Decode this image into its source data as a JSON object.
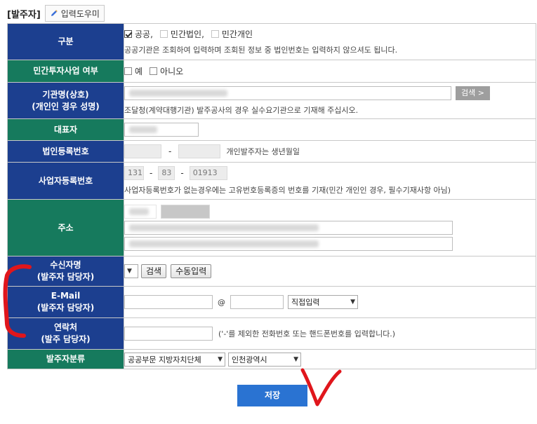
{
  "header": {
    "section_title": "[발주자]",
    "helper_button": "입력도우미"
  },
  "rows": {
    "category": {
      "label": "구분",
      "options": [
        {
          "label": "공공,",
          "checked": true
        },
        {
          "label": "민간법인,",
          "checked": false
        },
        {
          "label": "민간개인",
          "checked": false
        }
      ],
      "note": "공공기관은 조회하여 입력하며 조회된 정보 중 법인번호는 입력하지 않으셔도 됩니다."
    },
    "private_investment": {
      "label": "민간투자사업 여부",
      "options": [
        {
          "label": "예"
        },
        {
          "label": "아니오"
        }
      ]
    },
    "org_name": {
      "label_line1": "기관명(상호)",
      "label_line2": "(개인인 경우 성명)",
      "search_button": "검색 >",
      "note": "조달청(계약대행기관) 발주공사의 경우 실수요기관으로 기재해 주십시오."
    },
    "representative": {
      "label": "대표자"
    },
    "corp_reg_no": {
      "label": "법인등록번호",
      "separator": "-",
      "note": "개인발주자는 생년월일"
    },
    "biz_reg_no": {
      "label": "사업자등록번호",
      "part1": "131",
      "part2": "83",
      "part3": "01913",
      "separator": "-",
      "note": "사업자등록번호가 없는경우에는 고유번호등록증의 번호를 기재(민간 개인인 경우, 필수기재사항 아님)"
    },
    "address": {
      "label": "주소"
    },
    "recipient": {
      "label_line1": "수신자명",
      "label_line2": "(발주자 담당자)",
      "search_button": "검색",
      "manual_button": "수동입력"
    },
    "email": {
      "label_line1": "E-Mail",
      "label_line2": "(발주자 담당자)",
      "at": "@",
      "domain_select": "직접입력"
    },
    "contact": {
      "label_line1": "연락처",
      "label_line2": "(발주 담당자)",
      "note": "('-'를 제외한 전화번호 또는 핸드폰번호를 입력합니다.)"
    },
    "classification": {
      "label": "발주자분류",
      "select1": "공공부문 지방자치단체",
      "select2": "인천광역시"
    }
  },
  "actions": {
    "save": "저장"
  },
  "colors": {
    "navy": "#1c3f8f",
    "teal": "#167a5d",
    "save": "#2a73d2",
    "annotation": "#e0161c"
  }
}
